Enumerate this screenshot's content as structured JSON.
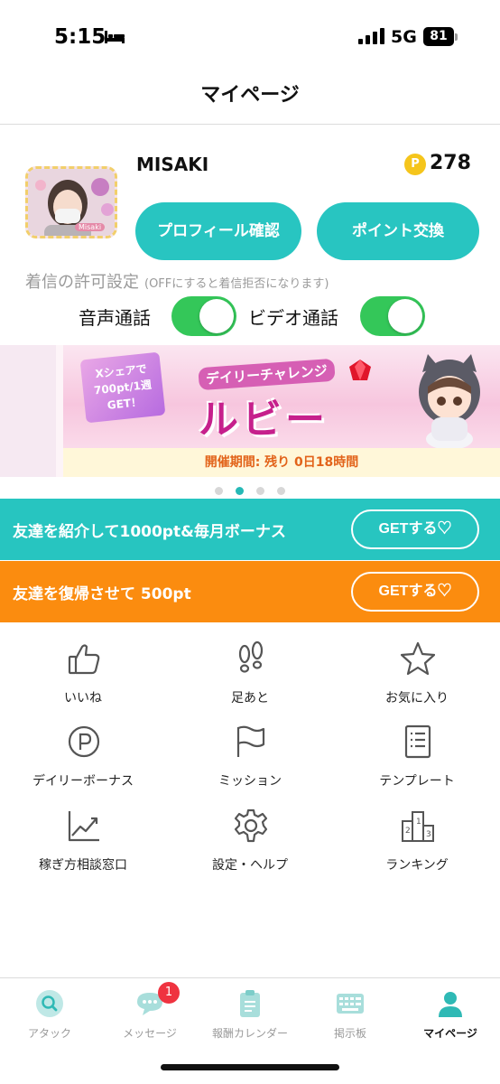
{
  "status_bar": {
    "time": "5:15",
    "network": "5G",
    "battery": "81"
  },
  "header": {
    "title": "マイページ"
  },
  "profile": {
    "name": "MISAKI",
    "avatar_name": "Misaki",
    "points_symbol": "P",
    "points": "278",
    "profile_button": "プロフィール確認",
    "exchange_button": "ポイント交換"
  },
  "call_settings": {
    "title": "着信の許可設定",
    "note": "(OFFにすると着信拒否になります)",
    "voice_label": "音声通話",
    "video_label": "ビデオ通話",
    "voice_on": true,
    "video_on": true
  },
  "banner": {
    "tag_line1": "Xシェアで",
    "tag_line2": "700pt/1週",
    "tag_line3": "GET！",
    "subtitle": "デイリーチャレンジ",
    "title": "ルビー",
    "period": "開催期間: 残り 0日18時間",
    "pages": 4,
    "active_page": 2
  },
  "promos": {
    "invite_text": "友達を紹介して1000pt&毎月ボーナス",
    "invite_button": "GETする♡",
    "return_text": "友達を復帰させて 500pt",
    "return_button": "GETする♡",
    "invite_color": "#27c5c0",
    "return_color": "#fb8c0f"
  },
  "menu": [
    {
      "label": "いいね",
      "icon": "thumbs-up-icon"
    },
    {
      "label": "足あと",
      "icon": "footprints-icon"
    },
    {
      "label": "お気に入り",
      "icon": "star-icon"
    },
    {
      "label": "デイリーボーナス",
      "icon": "p-coin-icon"
    },
    {
      "label": "ミッション",
      "icon": "flag-icon"
    },
    {
      "label": "テンプレート",
      "icon": "document-list-icon"
    },
    {
      "label": "稼ぎ方相談窓口",
      "icon": "trend-chart-icon"
    },
    {
      "label": "設定・ヘルプ",
      "icon": "gear-icon"
    },
    {
      "label": "ランキング",
      "icon": "podium-icon"
    }
  ],
  "tabs": [
    {
      "label": "アタック",
      "icon": "search-icon"
    },
    {
      "label": "メッセージ",
      "icon": "chat-icon",
      "badge": "1"
    },
    {
      "label": "報酬カレンダー",
      "icon": "clipboard-icon"
    },
    {
      "label": "掲示板",
      "icon": "keyboard-icon"
    },
    {
      "label": "マイページ",
      "icon": "person-icon",
      "active": true
    }
  ],
  "colors": {
    "accent": "#28c5c1",
    "toggle_on": "#34c759",
    "badge": "#ef3340"
  }
}
